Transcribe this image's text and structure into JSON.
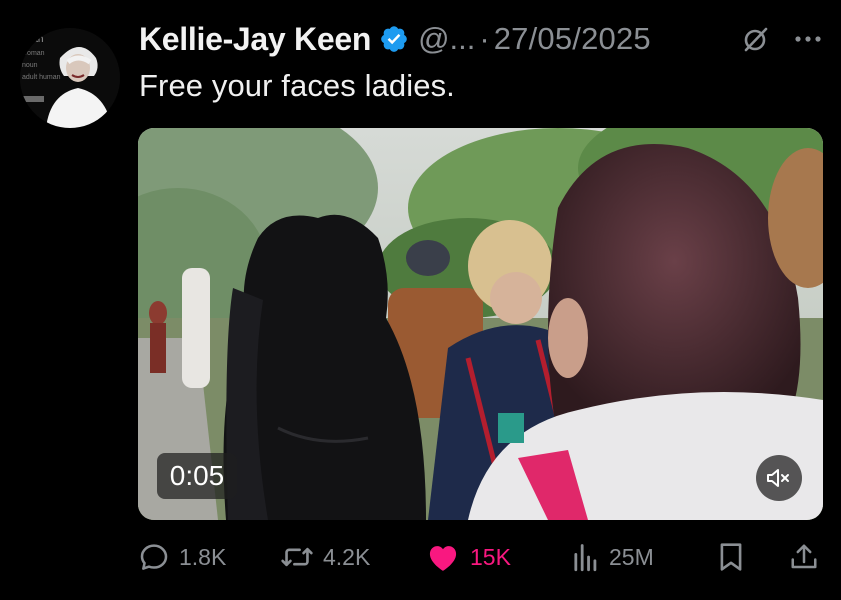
{
  "author": {
    "display_name": "Kellie-Jay Keen",
    "handle": "@...",
    "separator": "·",
    "date": "27/05/2025",
    "avatar_text": [
      "man",
      "woman",
      "noun",
      "adult human"
    ]
  },
  "tweet": {
    "text": "Free your faces ladies."
  },
  "media": {
    "type": "video",
    "duration": "0:05",
    "muted": true
  },
  "actions": {
    "replies": "1.8K",
    "reposts": "4.2K",
    "likes": "15K",
    "views": "25M",
    "liked": true
  },
  "colors": {
    "background": "#000000",
    "text": "#e7e9ea",
    "secondary": "#8b8f94",
    "verified": "#1d9bf0",
    "like": "#f91880"
  },
  "icons": {
    "verified": "verified-badge-icon",
    "grok": "grok-icon",
    "more": "more-icon",
    "reply": "reply-icon",
    "repost": "repost-icon",
    "like": "heart-icon",
    "views": "views-icon",
    "bookmark": "bookmark-icon",
    "share": "share-icon",
    "mute": "volume-muted-icon"
  }
}
